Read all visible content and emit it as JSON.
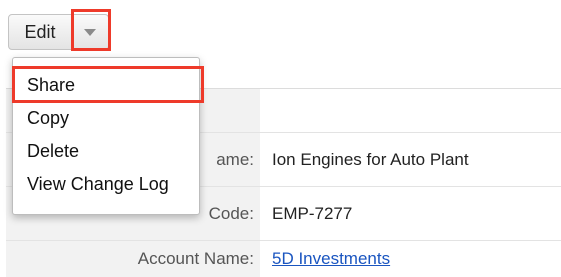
{
  "toolbar": {
    "edit_label": "Edit",
    "dropdown_icon": "caret-down-icon"
  },
  "menu": {
    "items": [
      {
        "label": "Share"
      },
      {
        "label": "Copy"
      },
      {
        "label": "Delete"
      },
      {
        "label": "View Change Log"
      }
    ]
  },
  "detail": {
    "rows": [
      {
        "label": "Opportunity Name:",
        "value": "Ion Engines for Auto Plant",
        "visible_label": "ame:"
      },
      {
        "label": "Code:",
        "value": "EMP-7277",
        "visible_label": "Code:"
      },
      {
        "label": "Account Name:",
        "value": "5D Investments"
      }
    ]
  },
  "colors": {
    "highlight": "#ee3a2a",
    "link": "#1a55c0",
    "label_bg": "#f2f2f2"
  }
}
